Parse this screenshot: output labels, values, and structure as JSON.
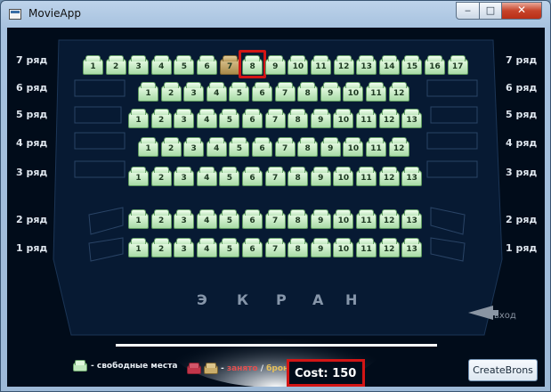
{
  "window": {
    "title": "MovieApp",
    "min_glyph": "‒",
    "max_glyph": "□",
    "close_glyph": "✕"
  },
  "rows": [
    {
      "label": "7 ряд",
      "seats": [
        "1",
        "2",
        "3",
        "4",
        "5",
        "6",
        "7",
        "8",
        "9",
        "10",
        "11",
        "12",
        "13",
        "14",
        "15",
        "16",
        "17"
      ],
      "booked_seat_index": 6,
      "selected_seat_index": 7
    },
    {
      "label": "6 ряд",
      "seats": [
        "1",
        "2",
        "3",
        "4",
        "5",
        "6",
        "7",
        "8",
        "9",
        "10",
        "11",
        "12"
      ]
    },
    {
      "label": "5 ряд",
      "seats": [
        "1",
        "2",
        "3",
        "4",
        "5",
        "6",
        "7",
        "8",
        "9",
        "10",
        "11",
        "12",
        "13"
      ]
    },
    {
      "label": "4 ряд",
      "seats": [
        "1",
        "2",
        "3",
        "4",
        "5",
        "6",
        "7",
        "8",
        "9",
        "10",
        "11",
        "12"
      ]
    },
    {
      "label": "3 ряд",
      "seats": [
        "1",
        "2",
        "3",
        "4",
        "5",
        "6",
        "7",
        "8",
        "9",
        "10",
        "11",
        "12",
        "13"
      ]
    },
    {
      "label": "2 ряд",
      "seats": [
        "1",
        "2",
        "3",
        "4",
        "5",
        "6",
        "7",
        "8",
        "9",
        "10",
        "11",
        "12",
        "13"
      ]
    },
    {
      "label": "1 ряд",
      "seats": [
        "1",
        "2",
        "3",
        "4",
        "5",
        "6",
        "7",
        "8",
        "9",
        "10",
        "11",
        "12",
        "13"
      ]
    }
  ],
  "screen": {
    "letters": [
      "Э",
      "К",
      "Р",
      "А",
      "Н"
    ]
  },
  "entrance": {
    "label": "вход"
  },
  "legend": {
    "free": "- свободные места",
    "taken_prefix": "- ",
    "taken": "занято",
    "slash": " / ",
    "bron": "бронь"
  },
  "cost": {
    "label": "Cost:",
    "value": "150"
  },
  "actions": {
    "create_label": "CreateBrons"
  },
  "colors": {
    "accent_highlight": "#d31515",
    "seat_free": "#bfe7bd",
    "seat_taken": "#c2364a",
    "seat_bron": "#c9ad6a",
    "hall_bg": "#010c1a"
  }
}
